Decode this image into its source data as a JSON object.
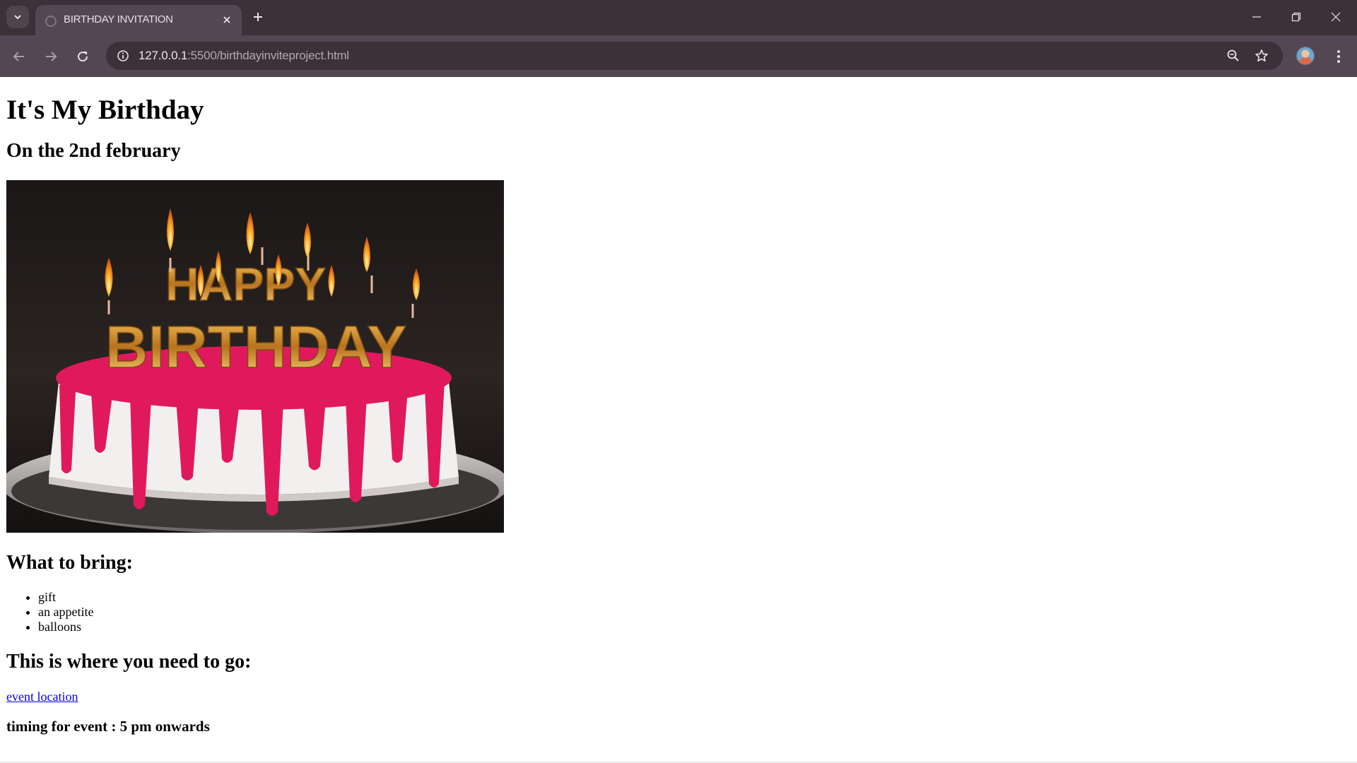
{
  "browser": {
    "tab_title": "BIRTHDAY INVITATION",
    "url_host": "127.0.0.1",
    "url_rest": ":5500/birthdayinviteproject.html",
    "icons": [
      "tab-search-icon",
      "favicon-icon",
      "close-icon",
      "plus-icon",
      "minimize-icon",
      "restore-icon",
      "window-close-icon",
      "back-arrow-icon",
      "forward-arrow-icon",
      "reload-icon",
      "info-icon",
      "zoom-out-icon",
      "star-icon",
      "profile-avatar",
      "kebab-menu-icon"
    ],
    "colors": {
      "tabstrip": "#3c3039",
      "toolbar": "#544652",
      "omnibox": "#3c3039"
    }
  },
  "page": {
    "heading": "It's My Birthday",
    "subheading": "On the 2nd february",
    "image": {
      "description": "cake-photo",
      "candle_letters": "HAPPY BIRTHDAY"
    },
    "bring_heading": "What to bring:",
    "bring_items": [
      "gift",
      "an appetite",
      "balloons"
    ],
    "go_heading": "This is where you need to go:",
    "location_link": "event location",
    "timing": "timing for event : 5 pm onwards",
    "colors": {
      "link": "#0000ee",
      "icing": "#e0195d"
    }
  }
}
